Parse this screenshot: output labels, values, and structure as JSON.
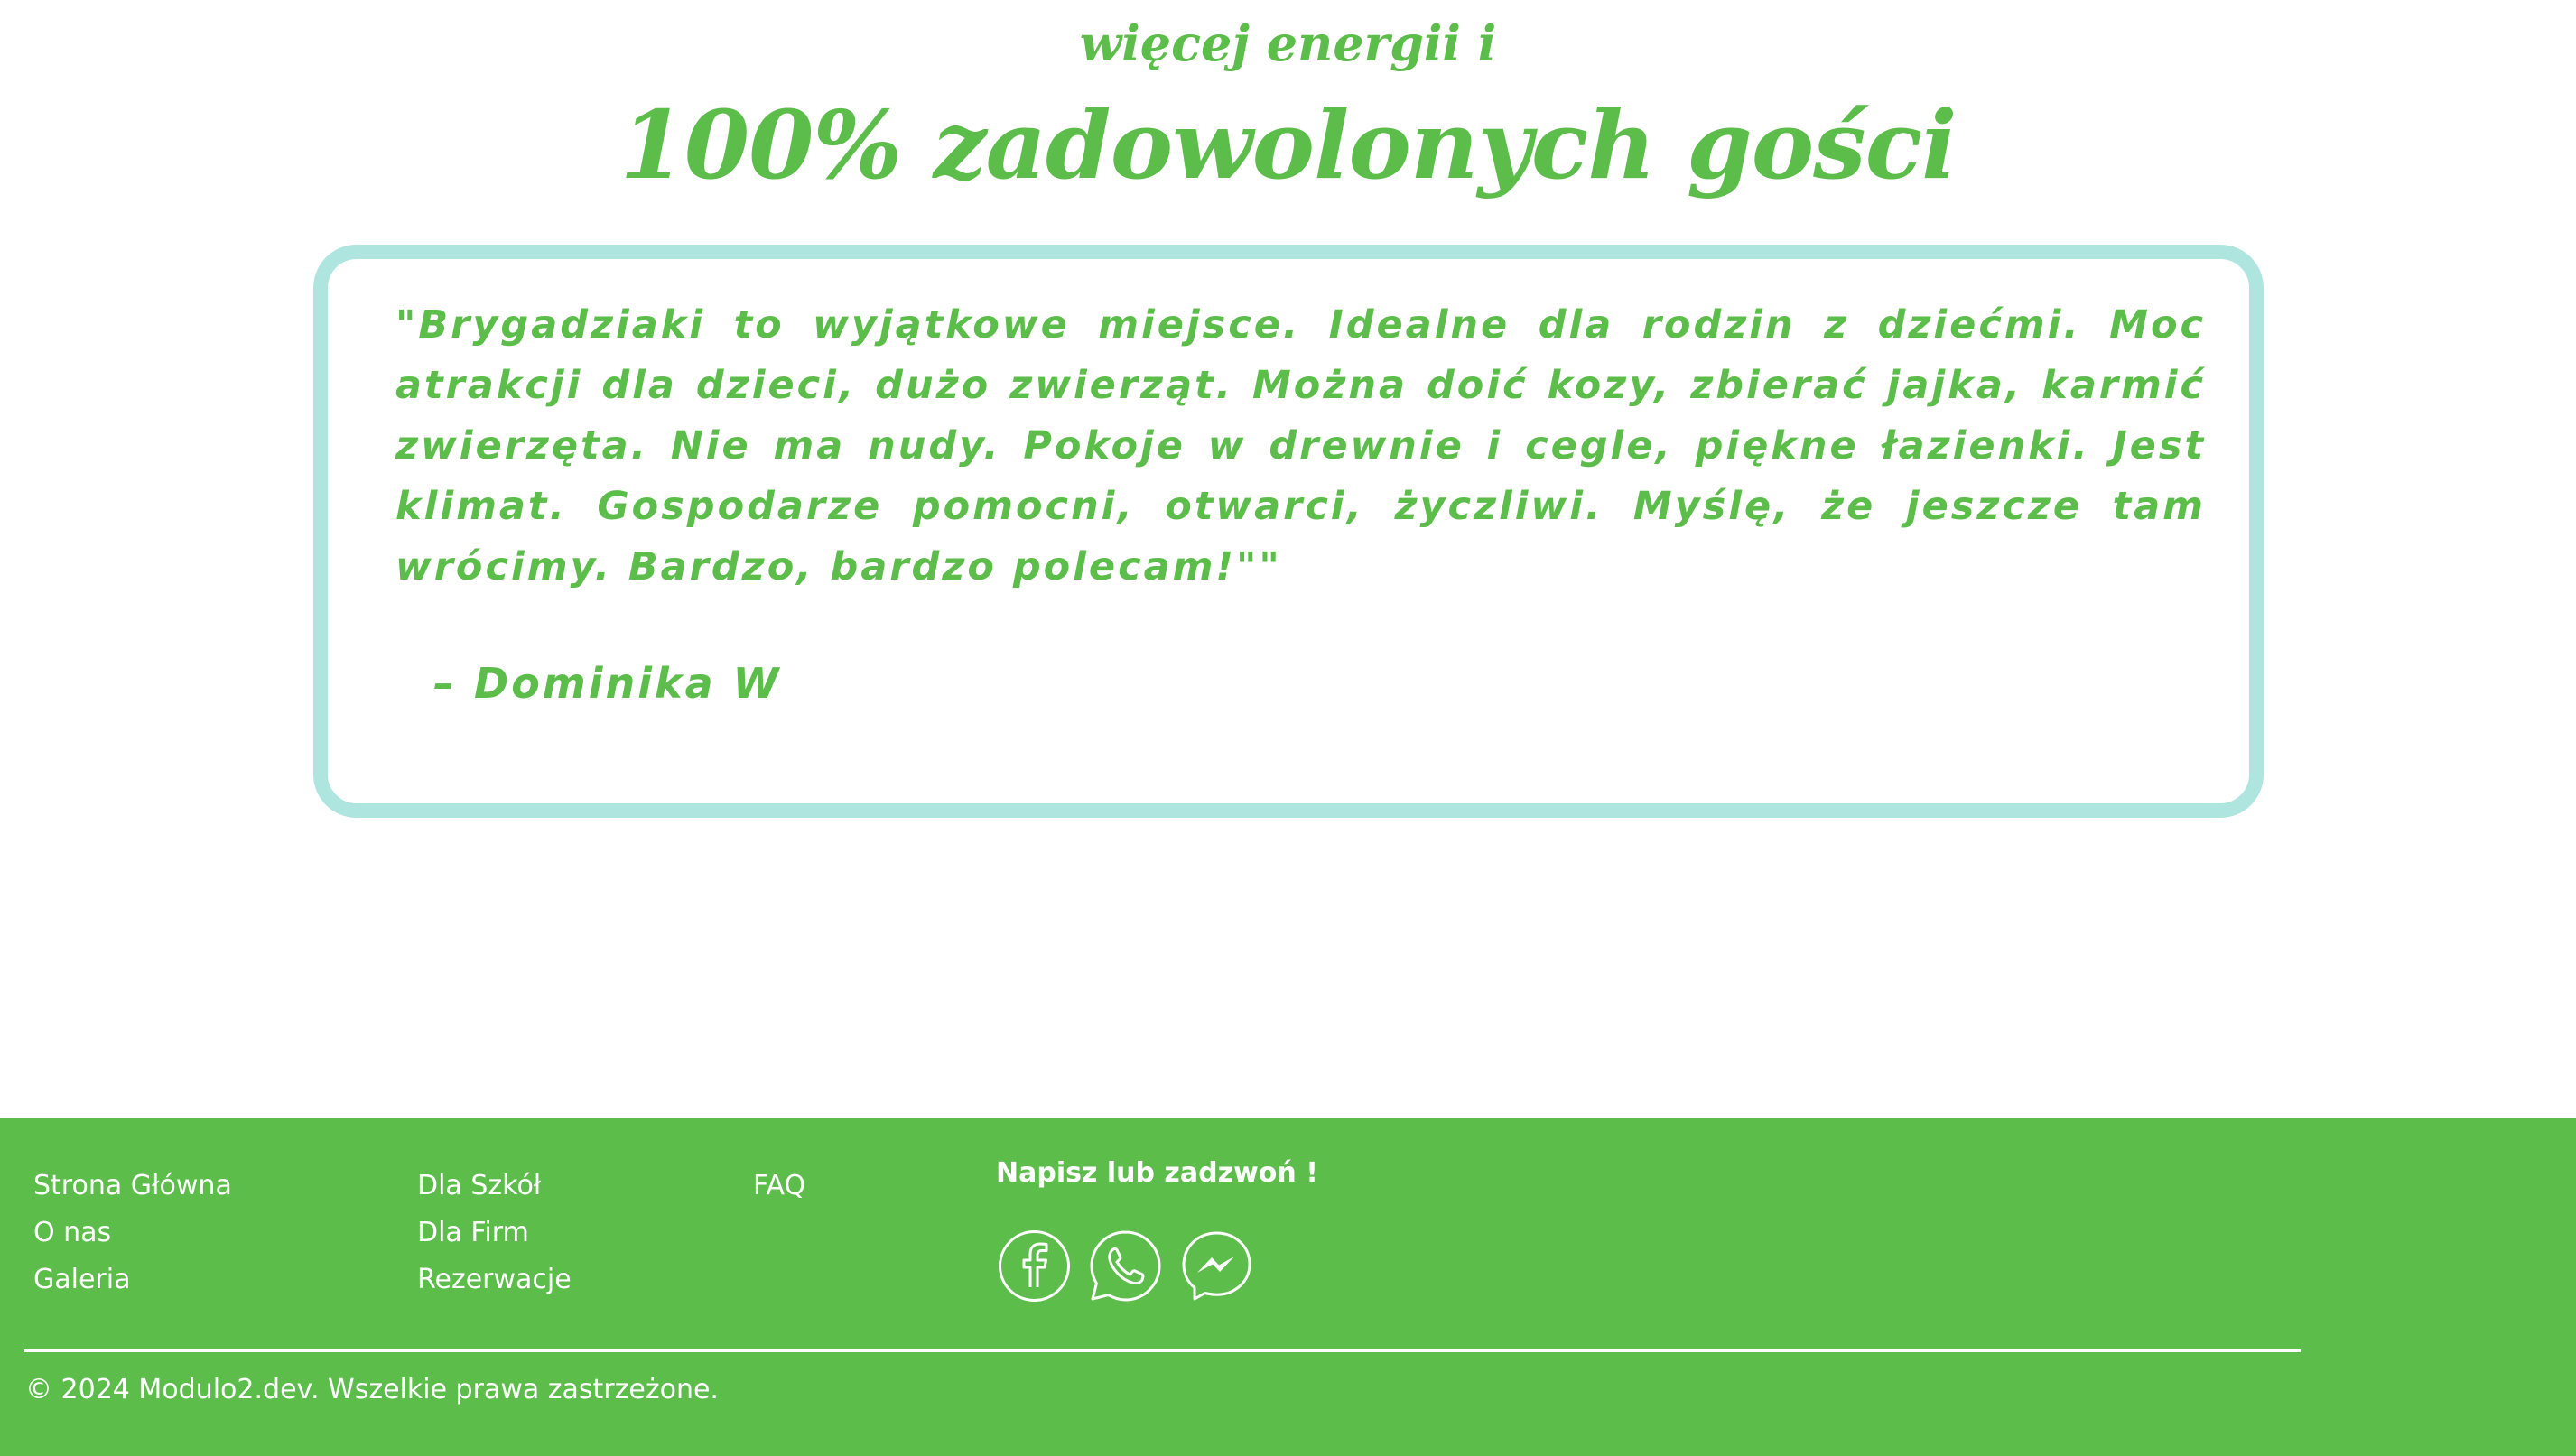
{
  "hero": {
    "subtitle": "więcej energii i",
    "title": "100% zadowolonych gości"
  },
  "review": {
    "text": "\"Brygadziaki to wyjątkowe miejsce. Idealne dla rodzin z dziećmi. Moc atrakcji dla dzieci, dużo zwierząt. Można doić kozy, zbierać jajka, karmić zwierzęta. Nie ma nudy. Pokoje w drewnie i cegle, piękne łazienki. Jest klimat. Gospodarze pomocni, otwarci, życzliwi. Myślę, że jeszcze tam wrócimy. Bardzo, bardzo polecam!\"\"",
    "author": "– Dominika W"
  },
  "footer": {
    "columns": [
      [
        "Strona Główna",
        "O nas",
        "Galeria"
      ],
      [
        "Dla Szkół",
        "Dla Firm",
        "Rezerwacje"
      ],
      [
        "FAQ"
      ]
    ],
    "contact_heading": "Napisz lub zadzwoń !",
    "social_icons": [
      "facebook-icon",
      "whatsapp-icon",
      "messenger-icon"
    ],
    "copyright": "© 2024 Modulo2.dev. Wszelkie prawa zastrzeżone."
  },
  "colors": {
    "brand_green": "#5cbd4b",
    "card_border": "#afe5df",
    "footer_text": "#ffffff"
  }
}
